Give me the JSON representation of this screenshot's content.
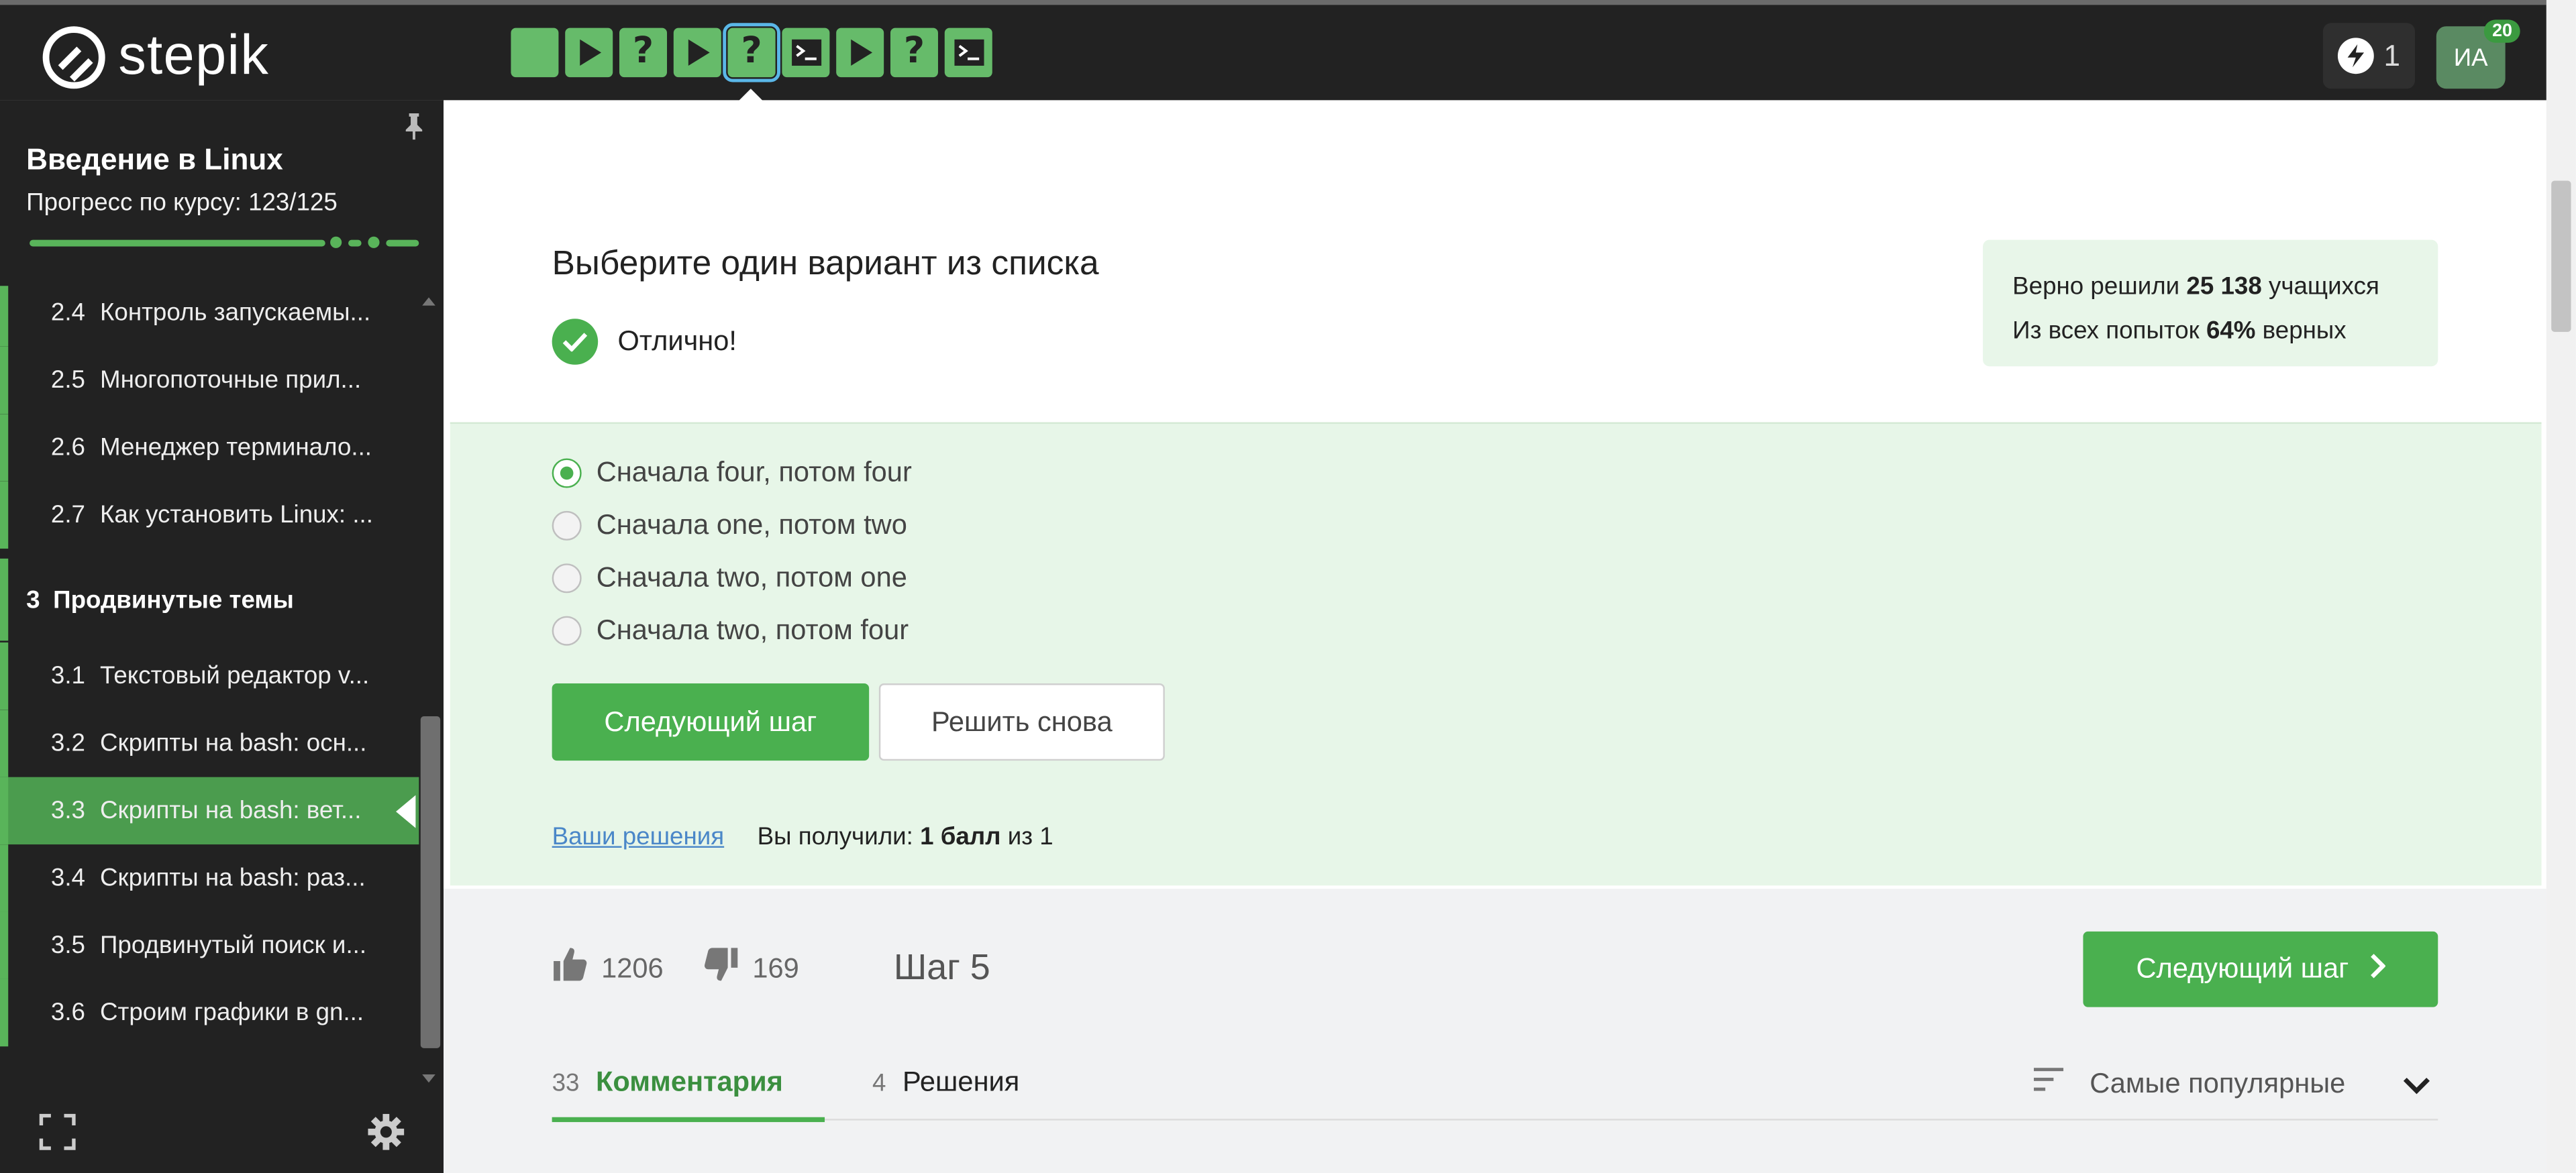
{
  "brand": {
    "name": "stepik"
  },
  "header": {
    "step_buttons": [
      {
        "type": "text",
        "label": ""
      },
      {
        "type": "video",
        "label": ""
      },
      {
        "type": "quiz",
        "label": "?"
      },
      {
        "type": "video",
        "label": ""
      },
      {
        "type": "quiz",
        "label": "?",
        "active": true
      },
      {
        "type": "code",
        "label": ""
      },
      {
        "type": "video",
        "label": ""
      },
      {
        "type": "quiz",
        "label": "?"
      },
      {
        "type": "code",
        "label": ""
      }
    ],
    "energy_count": "1",
    "avatar_initials": "ИА",
    "avatar_badge": "20"
  },
  "sidebar": {
    "course_title": "Введение в Linux",
    "progress_label": "Прогресс по курсу:  123/125",
    "progress_fraction": 0.984,
    "lessons_before": [
      {
        "num": "2.4",
        "title": "Контроль запускаемы..."
      },
      {
        "num": "2.5",
        "title": "Многопоточные прил..."
      },
      {
        "num": "2.6",
        "title": "Менеджер терминало..."
      },
      {
        "num": "2.7",
        "title": "Как установить Linux: ..."
      }
    ],
    "module": {
      "num": "3",
      "title": "Продвинутые темы"
    },
    "lessons_after": [
      {
        "num": "3.1",
        "title": "Текстовый редактор v..."
      },
      {
        "num": "3.2",
        "title": "Скрипты на bash: осн..."
      },
      {
        "num": "3.3",
        "title": "Скрипты на bash: вет..."
      },
      {
        "num": "3.4",
        "title": "Скрипты на bash: раз..."
      },
      {
        "num": "3.5",
        "title": "Продвинутый поиск и..."
      },
      {
        "num": "3.6",
        "title": "Строим графики в gn..."
      }
    ]
  },
  "quiz": {
    "title": "Выберите один вариант из списка",
    "result_text": "Отлично!",
    "stats": {
      "solved_prefix": "Верно решили ",
      "solved_count": "25 138",
      "solved_suffix": " учащихся",
      "attempts_prefix": "Из всех попыток ",
      "attempts_percent": "64%",
      "attempts_suffix": " верных"
    },
    "options": [
      {
        "label": "Сначала four, потом four",
        "checked": true
      },
      {
        "label": "Сначала one, потом two",
        "checked": false
      },
      {
        "label": "Сначала two, потом one",
        "checked": false
      },
      {
        "label": "Сначала two, потом four",
        "checked": false
      }
    ],
    "next_button": "Следующий шаг",
    "retry_button": "Решить снова",
    "solutions_link": "Ваши решения",
    "score_prefix": "Вы получили: ",
    "score_value": "1 балл",
    "score_suffix": " из 1"
  },
  "footer": {
    "likes": "1206",
    "dislikes": "169",
    "step_label": "Шаг 5",
    "next_button": "Следующий шаг",
    "tabs": [
      {
        "count": "33",
        "label": "Комментария",
        "active": true
      },
      {
        "count": "4",
        "label": "Решения",
        "active": false
      }
    ],
    "sort_label": "Самые популярные"
  },
  "colors": {
    "brand_green": "#4ab04f",
    "answer_bg": "#e7f6e8",
    "topbar": "#222222",
    "link": "#4a87c8"
  }
}
